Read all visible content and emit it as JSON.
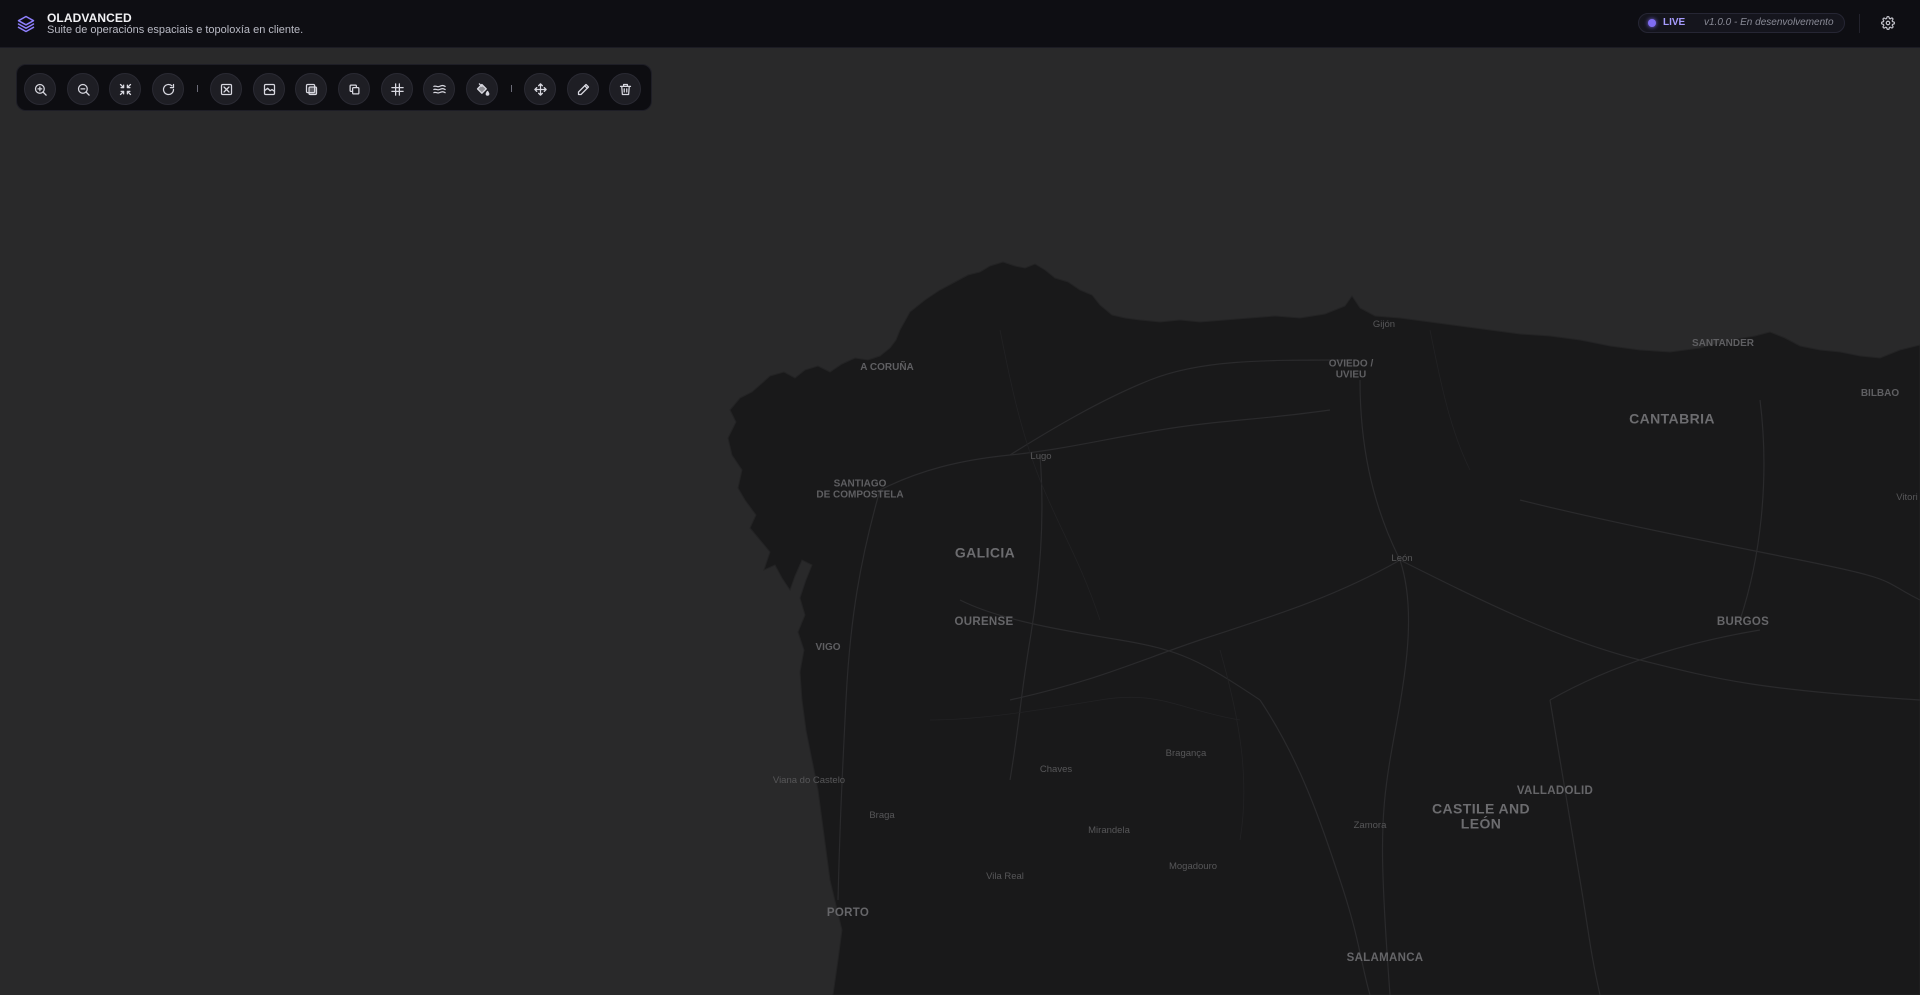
{
  "header": {
    "title": "OLADVANCED",
    "subtitle": "Suite de operacións espaciais e topoloxía en cliente.",
    "status_label": "LIVE",
    "version_label": "v1.0.0 - En desenvolvemento",
    "accent_color": "#7f6df2"
  },
  "toolbar": {
    "buttons": [
      {
        "name": "zoom-in",
        "icon": "zoom-in-icon"
      },
      {
        "name": "zoom-out",
        "icon": "zoom-out-icon"
      },
      {
        "name": "fit-extent",
        "icon": "collapse-arrows-icon"
      },
      {
        "name": "refresh",
        "icon": "refresh-icon"
      },
      {
        "name": "select-box",
        "icon": "select-box-icon"
      },
      {
        "name": "image-layer",
        "icon": "image-layer-icon"
      },
      {
        "name": "overlay",
        "icon": "overlay-icon"
      },
      {
        "name": "copy",
        "icon": "copy-icon"
      },
      {
        "name": "grid",
        "icon": "grid-icon"
      },
      {
        "name": "waves",
        "icon": "waves-icon"
      },
      {
        "name": "paint-bucket",
        "icon": "paint-bucket-icon"
      },
      {
        "name": "move",
        "icon": "move-icon"
      },
      {
        "name": "edit",
        "icon": "pencil-icon"
      },
      {
        "name": "delete",
        "icon": "trash-icon"
      }
    ]
  },
  "map": {
    "labels": {
      "gijon": "Gijón",
      "santander": "SANTANDER",
      "a_coruna": "A CORUÑA",
      "oviedo": "OVIEDO /\nUVIEU",
      "bilbao": "BILBAO",
      "cantabria": "CANTABRIA",
      "santiago": "SANTIAGO\nDE COMPOSTELA",
      "lugo": "Lugo",
      "vitoria": "Vitori",
      "galicia": "GALICIA",
      "leon": "León",
      "ourense": "OURENSE",
      "burgos": "BURGOS",
      "vigo": "VIGO",
      "braganca": "Bragança",
      "chaves": "Chaves",
      "viana": "Viana do Castelo",
      "valladolid": "VALLADOLID",
      "castile": "CASTILE AND\nLEÓN",
      "braga": "Braga",
      "zamora": "Zamora",
      "mirandela": "Mirandela",
      "mogadouro": "Mogadouro",
      "vila_real": "Vila Real",
      "porto": "PORTO",
      "salamanca": "SALAMANCA"
    }
  }
}
